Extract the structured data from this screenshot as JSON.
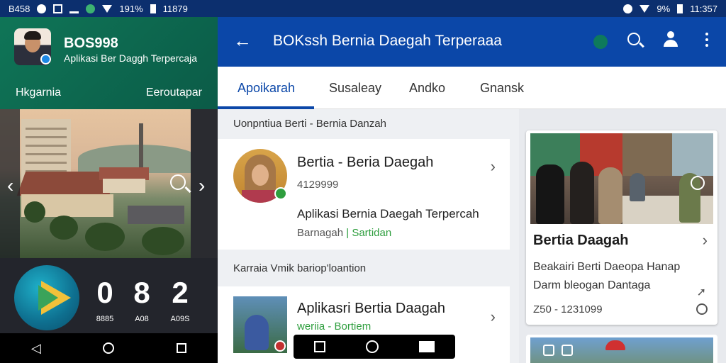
{
  "status": {
    "time_left": "B458",
    "battery_left": "191%",
    "clock_left": "11879",
    "battery_right": "9%",
    "clock_right": "11:357"
  },
  "left_panel": {
    "profile_title": "BOS998",
    "profile_subtitle": "Aplikasi Ber Daggh Terpercaja",
    "nav_left": "Hkgarnia",
    "nav_right": "Eeroutapar",
    "stats": [
      {
        "num": "0",
        "label": "8885"
      },
      {
        "num": "8",
        "label": "A08"
      },
      {
        "num": "2",
        "label": "A09S"
      }
    ]
  },
  "app_bar": {
    "title": "BOKssh Bernia Daegah Terperaaa"
  },
  "tabs": [
    {
      "label": "Apoikarah"
    },
    {
      "label": "Susaleay"
    },
    {
      "label": "Andko"
    },
    {
      "label": "Gnansk"
    }
  ],
  "feed": {
    "section1": "Uonpntiua Berti - Bernia Danzah",
    "card1": {
      "title": "Bertia - Beria Daegah",
      "number": "4129999",
      "desc": "Aplikasi Bernia Daegah Terpercah",
      "meta_left": "Barnagah",
      "meta_sep": "|",
      "meta_right": "Sartidan"
    },
    "section2": "Karraia Vmik bariop'loantion",
    "card2": {
      "title": "Aplikasri Bertia Daagah",
      "sub": "weriia - Bortiem"
    }
  },
  "side_card": {
    "title": "Bertia Daagah",
    "line1": "Beakairi Berti Daeopa Hanap",
    "line2": "Darm bleogan Dantaga",
    "meta": "Z50 - 1231099"
  },
  "colors": {
    "app_blue": "#0b47a8",
    "panel_green": "#0e6b52",
    "accent_green": "#2e9e3e"
  }
}
